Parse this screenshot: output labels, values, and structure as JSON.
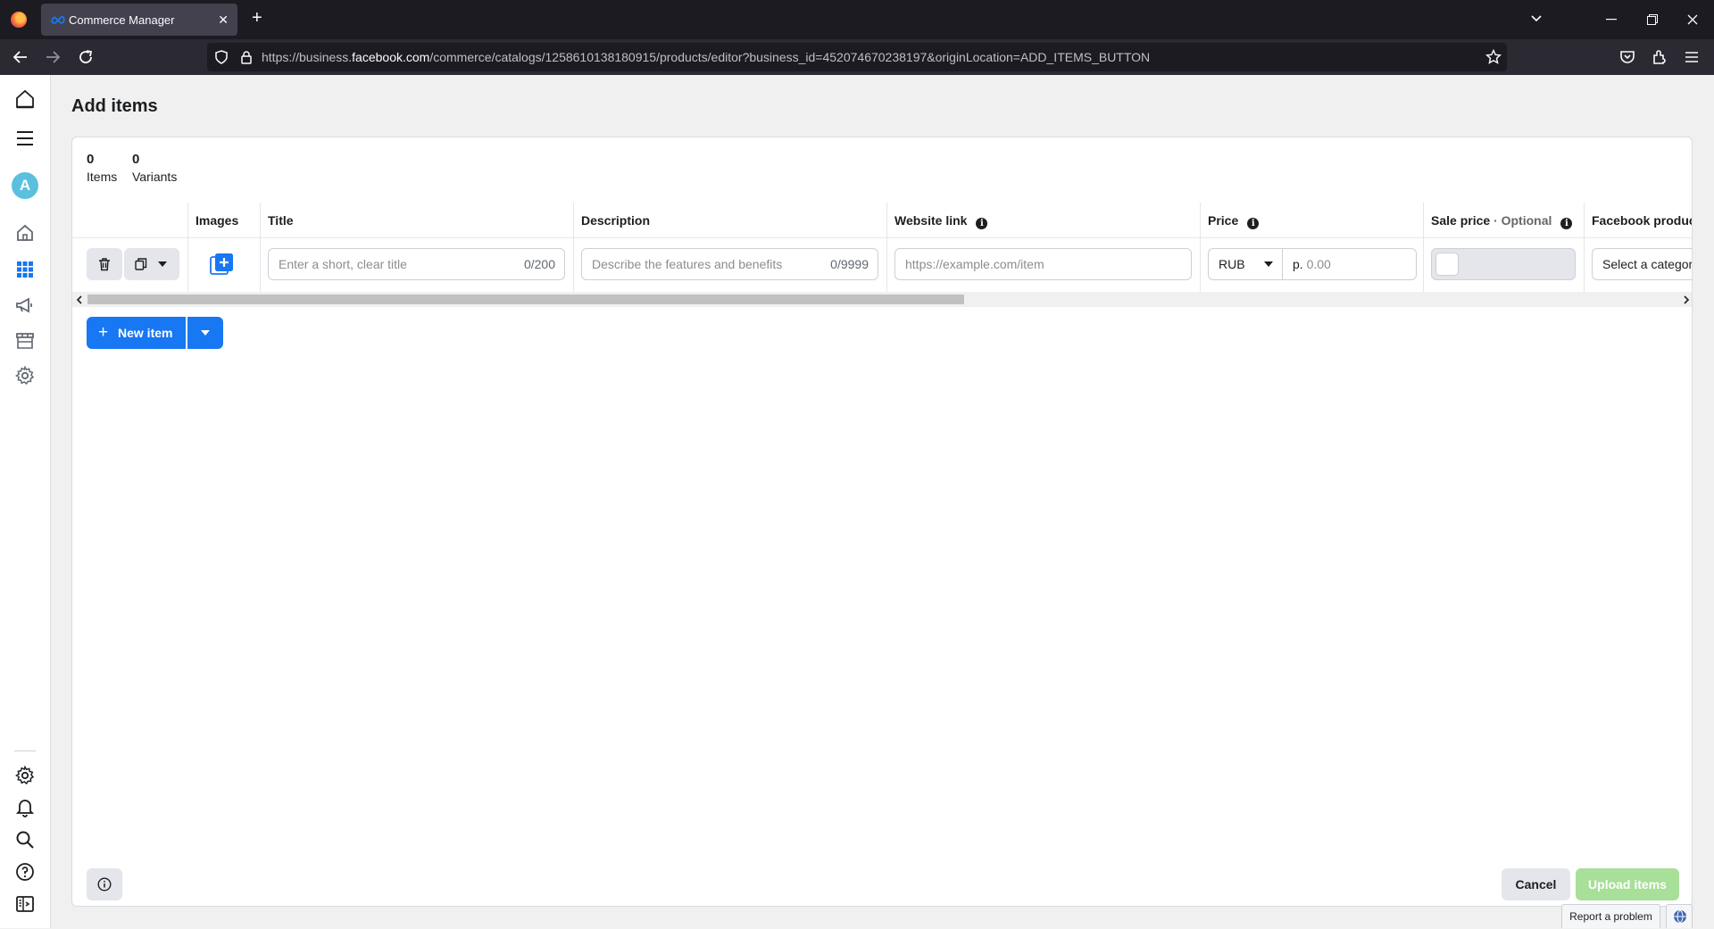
{
  "browser": {
    "tab_title": "Commerce Manager",
    "url_prefix": "https://business.",
    "url_host": "facebook.com",
    "url_path": "/commerce/catalogs/1258610138180915/products/editor?business_id=452074670238197&originLocation=ADD_ITEMS_BUTTON"
  },
  "sidebar": {
    "avatar_letter": "A"
  },
  "page": {
    "title": "Add items"
  },
  "stats": {
    "items_count": "0",
    "items_label": "Items",
    "variants_count": "0",
    "variants_label": "Variants"
  },
  "columns": {
    "images": "Images",
    "title": "Title",
    "description": "Description",
    "website_link": "Website link",
    "price": "Price",
    "sale_price": "Sale price",
    "sale_price_optional": "· Optional",
    "fb_category": "Facebook product category"
  },
  "row": {
    "title_placeholder": "Enter a short, clear title",
    "title_counter": "0/200",
    "description_placeholder": "Describe the features and benefits",
    "description_counter": "0/9999",
    "website_placeholder": "https://example.com/item",
    "currency": "RUB",
    "price_prefix": "р.",
    "price_placeholder": "0.00",
    "category_placeholder": "Select a category"
  },
  "actions": {
    "new_item": "New item",
    "cancel": "Cancel",
    "upload": "Upload items",
    "report": "Report a problem"
  },
  "colors": {
    "primary": "#1877f2",
    "upload_disabled": "#a8df99",
    "browser_dark": "#1c1b22"
  }
}
